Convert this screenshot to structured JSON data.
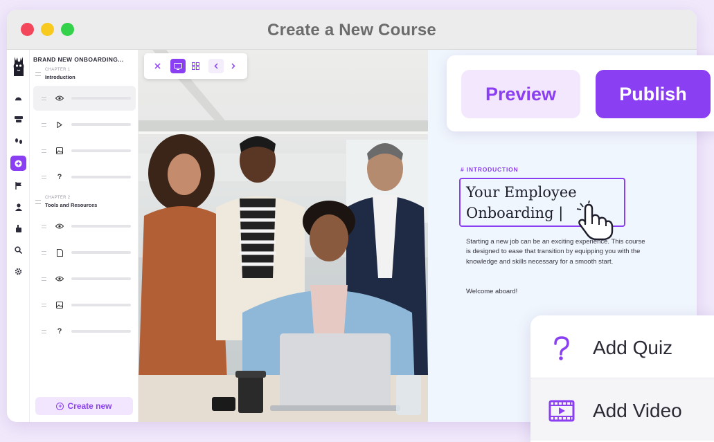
{
  "window": {
    "title": "Create a New Course"
  },
  "colors": {
    "accent": "#8b3ff2",
    "accent_soft": "#f3e7fd",
    "editor_bg": "#f0f6fd"
  },
  "rail": {
    "icons": [
      "logo-llama-icon",
      "dashboard-icon",
      "layers-icon",
      "footprints-icon",
      "add-icon",
      "flag-icon",
      "user-icon",
      "plugin-icon",
      "search-icon",
      "gear-icon"
    ],
    "active": "add-icon"
  },
  "outline": {
    "course_name": "BRAND NEW ONBOARDING...",
    "chapters": [
      {
        "num": "CHAPTER 1",
        "title": "Introduction",
        "lessons": [
          "eye-icon",
          "play-icon",
          "image-icon",
          "quiz-icon"
        ]
      },
      {
        "num": "CHAPTER 2",
        "title": "Tools and Resources",
        "lessons": [
          "eye-icon",
          "document-icon",
          "eye-icon",
          "image-icon",
          "quiz-icon"
        ]
      }
    ],
    "create_new": "Create new"
  },
  "toolbar": {
    "buttons": [
      "close-icon",
      "desktop-icon",
      "grid-icon",
      "chevron-left-icon",
      "chevron-right-icon"
    ],
    "active": "desktop-icon"
  },
  "actions": {
    "preview": "Preview",
    "publish": "Publish"
  },
  "editor": {
    "section_label": "# INTRODUCTION",
    "headline_line1": "Your Employee",
    "headline_line2": "Onboarding |",
    "body": "Starting a new job can be an exciting experience. This course is designed to ease that transition by equipping you with the knowledge and skills necessary for a smooth start.",
    "welcome": "Welcome aboard!"
  },
  "add_menu": {
    "quiz": "Add Quiz",
    "video": "Add Video"
  }
}
